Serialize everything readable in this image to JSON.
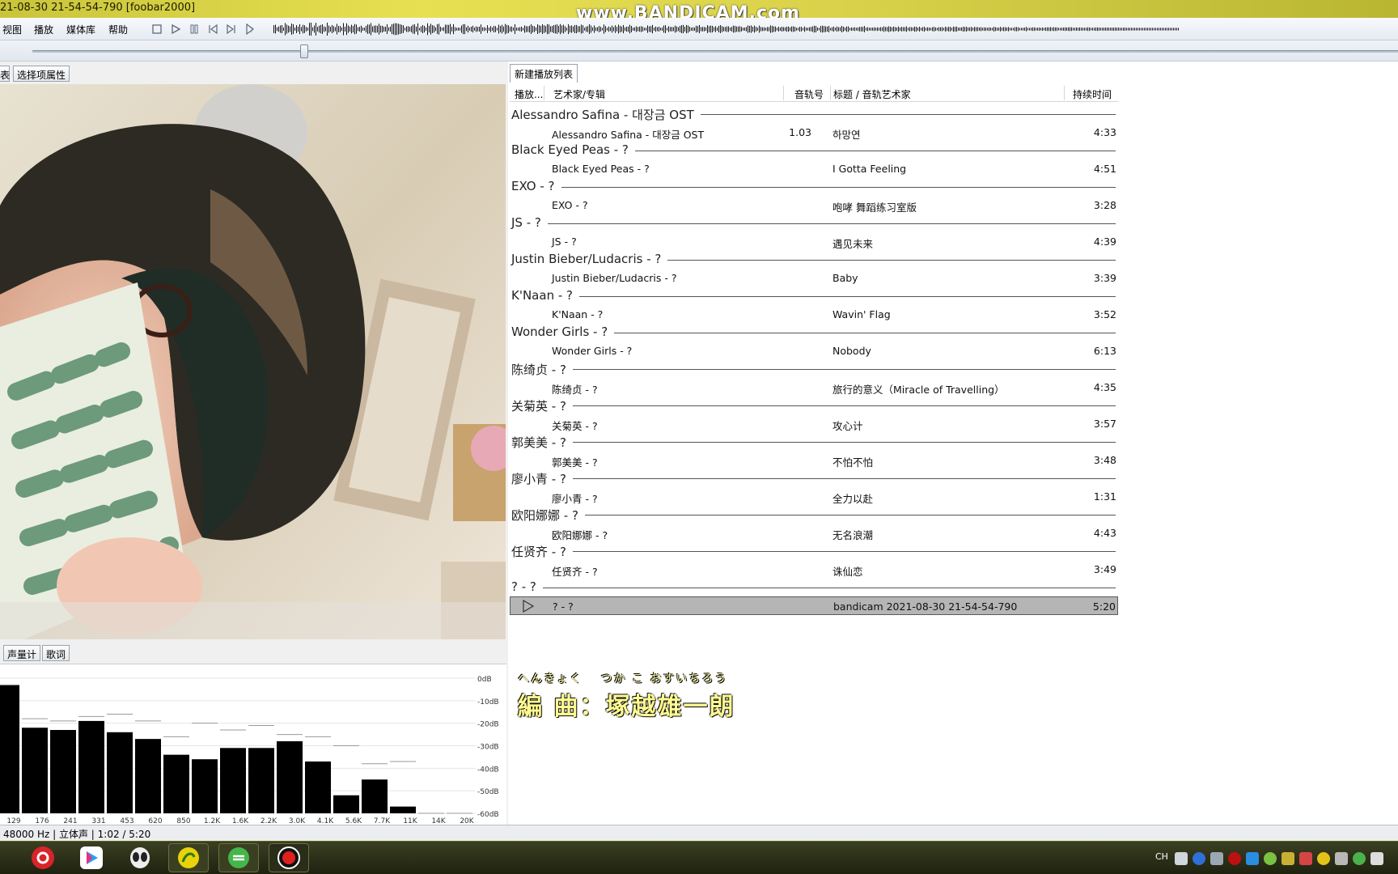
{
  "window": {
    "title": "21-08-30 21-54-54-790  [foobar2000]",
    "watermark": "www.BANDICAM.com"
  },
  "menu": {
    "items": [
      "视图",
      "播放",
      "媒体库",
      "帮助"
    ]
  },
  "toolbar": {
    "buttons": [
      "stop-icon",
      "play-icon",
      "pause-icon",
      "previous-icon",
      "next-icon",
      "random-icon"
    ]
  },
  "seek": {
    "position_fraction": 0.196
  },
  "left_tabs": {
    "tab_cut": "表",
    "tab_props": "选择项属性"
  },
  "bottom_tabs": {
    "tab_meter": "声量计",
    "tab_lyrics": "歌词"
  },
  "spectrum": {
    "db_labels": [
      "0dB",
      "-10dB",
      "-20dB",
      "-30dB",
      "-40dB",
      "-50dB",
      "-60dB"
    ],
    "freq_labels": [
      "129",
      "176",
      "241",
      "331",
      "453",
      "620",
      "850",
      "1.2K",
      "1.6K",
      "2.2K",
      "3.0K",
      "4.1K",
      "5.6K",
      "7.7K",
      "11K",
      "14K",
      "20K"
    ],
    "bar_levels_db": [
      -3,
      -22,
      -23,
      -19,
      -24,
      -27,
      -34,
      -36,
      -31,
      -31,
      -28,
      -37,
      -52,
      -45,
      -57,
      -60,
      -60
    ],
    "peak_levels_db": [
      -3,
      -18,
      -19,
      -17,
      -16,
      -19,
      -26,
      -20,
      -23,
      -21,
      -25,
      -26,
      -30,
      -38,
      -37,
      -60,
      -60
    ]
  },
  "playlist": {
    "tab": "新建播放列表",
    "headers": {
      "playing": "播放...",
      "artist_album": "艺术家/专辑",
      "track_no": "音轨号",
      "title_artist": "标题 / 音轨艺术家",
      "duration": "持续时间"
    },
    "groups": [
      {
        "name": "Alessandro Safina - 대장금 OST",
        "tracks": [
          {
            "artist": "Alessandro Safina - 대장금 OST",
            "num": "1.03",
            "title": "하망연",
            "dur": "4:33"
          }
        ]
      },
      {
        "name": "Black Eyed Peas - ?",
        "tracks": [
          {
            "artist": "Black Eyed Peas - ?",
            "num": "",
            "title": "I Gotta Feeling",
            "dur": "4:51"
          }
        ]
      },
      {
        "name": "EXO - ?",
        "tracks": [
          {
            "artist": "EXO - ?",
            "num": "",
            "title": "咆哮 舞蹈练习室版",
            "dur": "3:28"
          }
        ]
      },
      {
        "name": "JS - ?",
        "tracks": [
          {
            "artist": "JS - ?",
            "num": "",
            "title": "遇见未来",
            "dur": "4:39"
          }
        ]
      },
      {
        "name": "Justin Bieber/Ludacris - ?",
        "tracks": [
          {
            "artist": "Justin Bieber/Ludacris - ?",
            "num": "",
            "title": "Baby",
            "dur": "3:39"
          }
        ]
      },
      {
        "name": "K'Naan - ?",
        "tracks": [
          {
            "artist": "K'Naan - ?",
            "num": "",
            "title": "Wavin' Flag",
            "dur": "3:52"
          }
        ]
      },
      {
        "name": "Wonder Girls - ?",
        "tracks": [
          {
            "artist": "Wonder Girls - ?",
            "num": "",
            "title": "Nobody",
            "dur": "6:13"
          }
        ]
      },
      {
        "name": "陈绮贞 - ?",
        "tracks": [
          {
            "artist": "陈绮贞 - ?",
            "num": "",
            "title": "旅行的意义（Miracle of Travelling）",
            "dur": "4:35"
          }
        ]
      },
      {
        "name": "关菊英 - ?",
        "tracks": [
          {
            "artist": "关菊英 - ?",
            "num": "",
            "title": "攻心计",
            "dur": "3:57"
          }
        ]
      },
      {
        "name": "郭美美 - ?",
        "tracks": [
          {
            "artist": "郭美美 - ?",
            "num": "",
            "title": "不怕不怕",
            "dur": "3:48"
          }
        ]
      },
      {
        "name": "廖小青 - ?",
        "tracks": [
          {
            "artist": "廖小青 - ?",
            "num": "",
            "title": "全力以赴",
            "dur": "1:31"
          }
        ]
      },
      {
        "name": "欧阳娜娜 - ?",
        "tracks": [
          {
            "artist": "欧阳娜娜 - ?",
            "num": "",
            "title": "无名浪潮",
            "dur": "4:43"
          }
        ]
      },
      {
        "name": "任贤齐 - ?",
        "tracks": [
          {
            "artist": "任贤齐 - ?",
            "num": "",
            "title": "诛仙恋",
            "dur": "3:49"
          }
        ]
      },
      {
        "name": "? - ?",
        "tracks": [
          {
            "artist": "? - ?",
            "num": "",
            "title": "bandicam 2021-08-30 21-54-54-790",
            "dur": "5:20",
            "playing": true
          }
        ]
      }
    ]
  },
  "lyrics": {
    "ruby": "へんきょく　 つか こ おすいちろう",
    "line": "編 曲：塚越雄一朗"
  },
  "status": {
    "text": "48000 Hz | 立体声 | 1:02 / 5:20"
  },
  "taskbar": {
    "apps": [
      "netease-music-icon",
      "youku-icon",
      "alien-app-icon",
      "yellow-app-icon",
      "green-app-icon",
      "bandicam-record-icon"
    ],
    "lang": "CH"
  },
  "colors": {
    "playing_row": "#b5b5b5",
    "bar": "#000000",
    "lyrics": "#fffb90"
  }
}
